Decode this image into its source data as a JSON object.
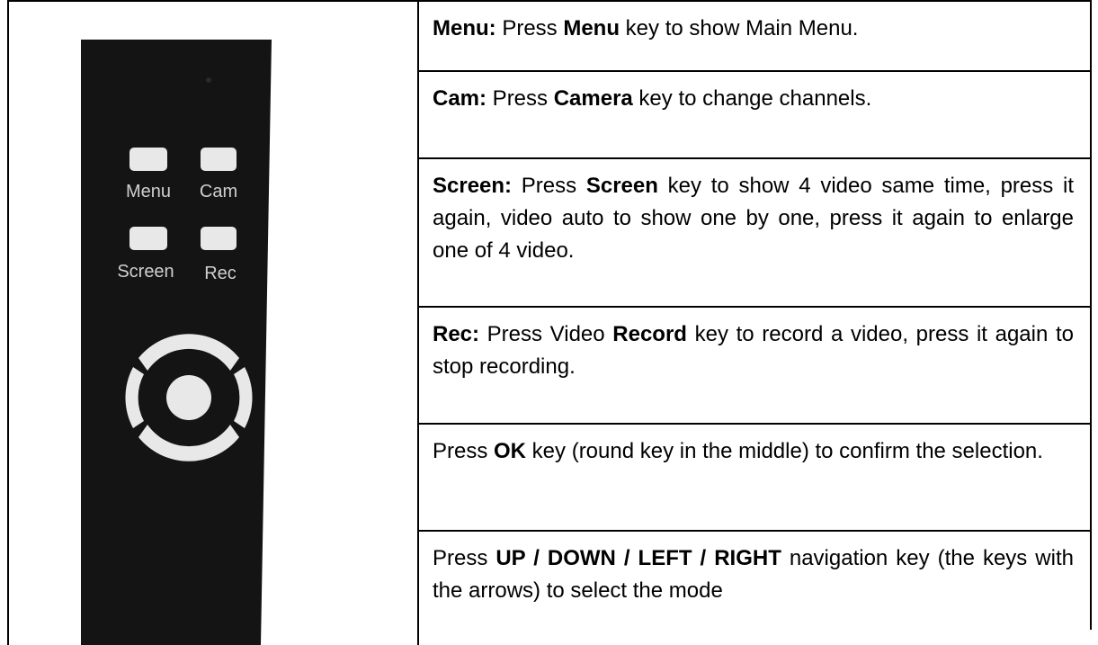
{
  "remote": {
    "keys": {
      "menu_label": "Menu",
      "cam_label": "Cam",
      "screen_label": "Screen",
      "rec_label": "Rec"
    },
    "colors": {
      "body": "#141414",
      "key": "#e8e8e8",
      "label": "#cfcfcf"
    }
  },
  "instructions": [
    {
      "lead": "Menu:",
      "pre": " Press ",
      "key": "Menu",
      "post": " key to show Main Menu."
    },
    {
      "lead": "Cam:",
      "pre": " Press ",
      "key": "Camera",
      "post": " key to change channels."
    },
    {
      "lead": "Screen:",
      "pre": " Press ",
      "key": "Screen",
      "post": " key to show 4 video same time, press it again, video auto to show one by one, press it again to enlarge one of 4 video."
    },
    {
      "lead": "Rec:",
      "pre": " Press Video ",
      "key": "Record",
      "post": " key to record a video, press it again to stop recording."
    },
    {
      "lead": "",
      "pre": "Press ",
      "key": "OK",
      "post": " key (round key in the middle) to confirm the selection."
    },
    {
      "lead": "",
      "pre": "Press ",
      "key": "UP / DOWN / LEFT / RIGHT",
      "post": " navigation key (the keys with the arrows) to select the mode"
    }
  ]
}
